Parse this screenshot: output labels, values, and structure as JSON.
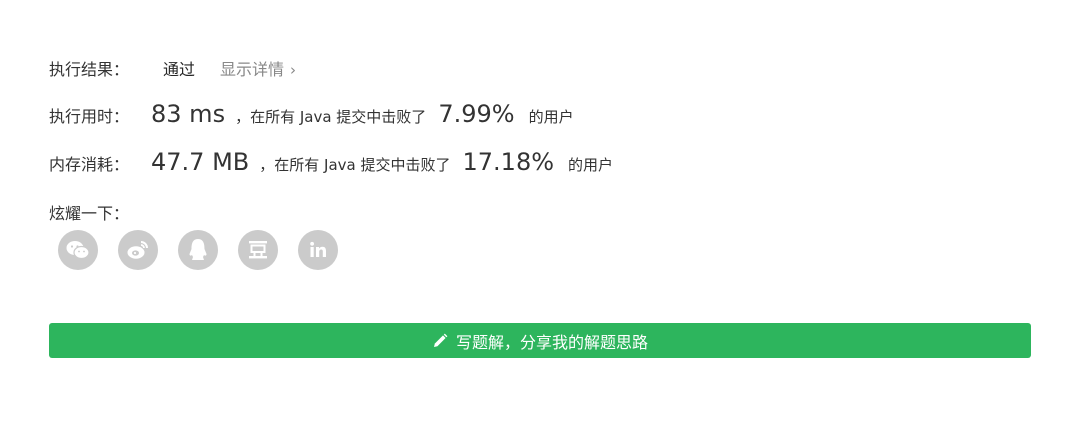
{
  "result": {
    "label": "执行结果：",
    "status": "通过",
    "details": "显示详情",
    "chevron": "›"
  },
  "runtime": {
    "label": "执行用时：",
    "value": "83 ms",
    "sentence": "，在所有 Java 提交中击败了",
    "percent": "7.99%",
    "suffix": "的用户"
  },
  "memory": {
    "label": "内存消耗：",
    "value": "47.7 MB",
    "sentence": "，在所有 Java 提交中击败了",
    "percent": "17.18%",
    "suffix": "的用户"
  },
  "share": {
    "label": "炫耀一下：",
    "icons": [
      "wechat-icon",
      "weibo-icon",
      "qq-icon",
      "douban-icon",
      "linkedin-icon"
    ]
  },
  "cta": {
    "label": "写题解，分享我的解题思路",
    "icon": "pencil-icon"
  },
  "colors": {
    "accent": "#2db55d",
    "icon_gray": "#cbcbcb"
  }
}
